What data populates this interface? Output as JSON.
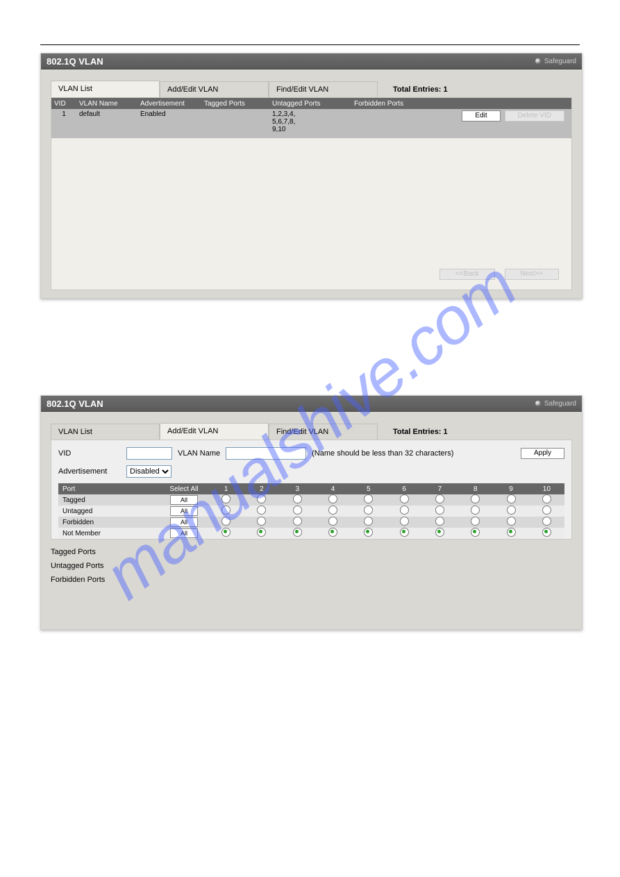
{
  "watermark": "manualshive.com",
  "titlebar": {
    "title": "802.1Q VLAN",
    "safeguard": "Safeguard"
  },
  "tabs": {
    "vlan_list": "VLAN List",
    "add_edit": "Add/Edit VLAN",
    "find_edit": "Find/Edit VLAN",
    "total_label": "Total Entries:",
    "total_value": "1"
  },
  "list": {
    "headers": {
      "vid": "VID",
      "name": "VLAN Name",
      "adv": "Advertisement",
      "tagged": "Tagged Ports",
      "untagged": "Untagged Ports",
      "forbidden": "Forbidden Ports"
    },
    "row": {
      "vid": "1",
      "name": "default",
      "adv": "Enabled",
      "tagged": "",
      "untagged": "1,2,3,4,\n5,6,7,8,\n9,10",
      "forbidden": "",
      "edit": "Edit",
      "delete": "Delete VID"
    },
    "pager": {
      "back": "<<Back",
      "next": "Next>>"
    }
  },
  "form": {
    "vid_label": "VID",
    "name_label": "VLAN Name",
    "name_hint": "(Name should be less than 32 characters)",
    "apply": "Apply",
    "adv_label": "Advertisement",
    "adv_value": "Disabled",
    "grid": {
      "port_header": "Port",
      "select_all": "Select All",
      "cols": [
        "1",
        "2",
        "3",
        "4",
        "5",
        "6",
        "7",
        "8",
        "9",
        "10"
      ],
      "rows": [
        {
          "label": "Tagged",
          "all": "All",
          "selected": []
        },
        {
          "label": "Untagged",
          "all": "All",
          "selected": []
        },
        {
          "label": "Forbidden",
          "all": "All",
          "selected": []
        },
        {
          "label": "Not Member",
          "all": "All",
          "selected": [
            "1",
            "2",
            "3",
            "4",
            "5",
            "6",
            "7",
            "8",
            "9",
            "10"
          ]
        }
      ]
    },
    "summary": {
      "tagged": "Tagged Ports",
      "untagged": "Untagged Ports",
      "forbidden": "Forbidden Ports"
    }
  }
}
